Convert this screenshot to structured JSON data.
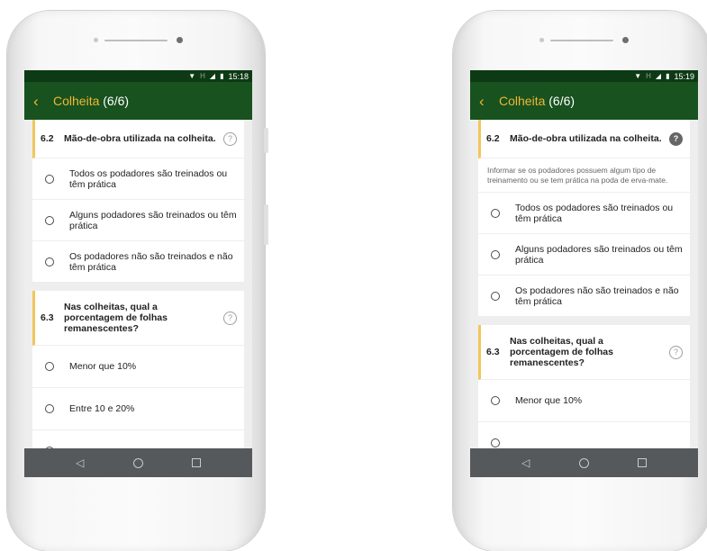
{
  "screens": [
    {
      "status": {
        "time": "15:18",
        "network_label": "H"
      },
      "appbar": {
        "title": "Colheita",
        "count": "(6/6)"
      },
      "questions": [
        {
          "number": "6.2",
          "text": "Mão-de-obra utilizada na colheita.",
          "help": "?",
          "help_active": false,
          "description": "",
          "options": [
            "Todos os podadores são treinados ou têm prática",
            "Alguns podadores são treinados ou têm prática",
            "Os podadores não são treinados e não têm prática"
          ]
        },
        {
          "number": "6.3",
          "text": "Nas colheitas, qual a porcentagem de folhas remanescentes?",
          "help": "?",
          "help_active": false,
          "description": "",
          "options": [
            "Menor que 10%",
            "Entre 10 e 20%",
            ""
          ]
        }
      ]
    },
    {
      "status": {
        "time": "15:19",
        "network_label": "H"
      },
      "appbar": {
        "title": "Colheita",
        "count": "(6/6)"
      },
      "questions": [
        {
          "number": "6.2",
          "text": "Mão-de-obra utilizada na colheita.",
          "help": "?",
          "help_active": true,
          "description": "Informar se os podadores possuem algum tipo de treinamento ou se tem prática na poda de erva-mate.",
          "options": [
            "Todos os podadores são treinados ou têm prática",
            "Alguns podadores são treinados ou têm prática",
            "Os podadores não são treinados e não têm prática"
          ]
        },
        {
          "number": "6.3",
          "text": "Nas colheitas, qual a porcentagem de folhas remanescentes?",
          "help": "?",
          "help_active": false,
          "description": "",
          "options": [
            "Menor que 10%",
            ""
          ]
        }
      ]
    }
  ],
  "colors": {
    "appbar": "#18521f",
    "statusbar": "#0d3a14",
    "accent": "#f2b632",
    "navbar": "#55595c"
  },
  "icons": {
    "back": "chevron-left-icon",
    "help": "question-circle-icon",
    "wifi": "wifi-icon",
    "signal": "signal-icon",
    "battery": "battery-icon"
  },
  "navbar": {
    "back": "◁",
    "home": "circle",
    "recent": "square"
  }
}
